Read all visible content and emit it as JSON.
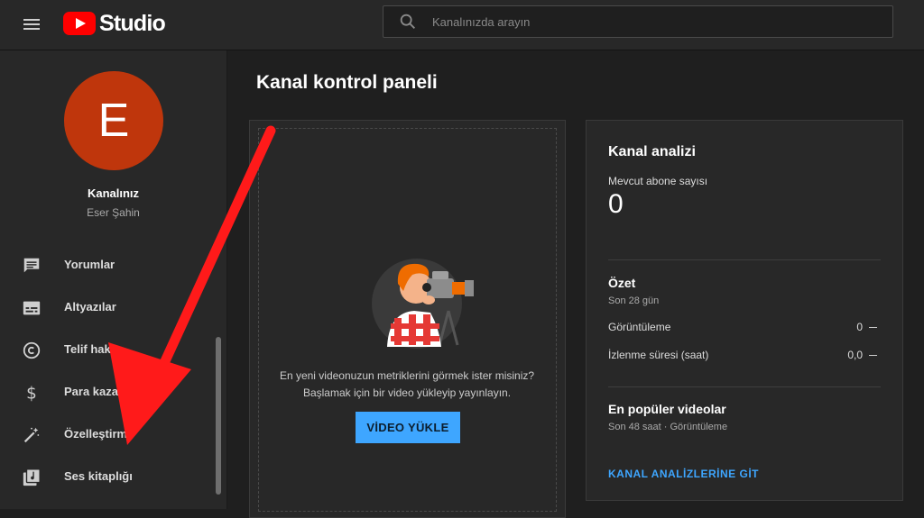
{
  "header": {
    "logo_text": "Studio",
    "search_placeholder": "Kanalınızda arayın"
  },
  "channel": {
    "avatar_letter": "E",
    "avatar_color": "#bf360c",
    "name": "Kanalınız",
    "owner": "Eser Şahin"
  },
  "sidebar": {
    "items": [
      {
        "label": "Yorumlar",
        "icon": "comment-icon"
      },
      {
        "label": "Altyazılar",
        "icon": "subtitles-icon"
      },
      {
        "label": "Telif hakkı",
        "icon": "copyright-icon"
      },
      {
        "label": "Para kazanma",
        "icon": "dollar-icon"
      },
      {
        "label": "Özelleştirme",
        "icon": "magic-wand-icon"
      },
      {
        "label": "Ses kitaplığı",
        "icon": "audio-library-icon"
      }
    ]
  },
  "main": {
    "title": "Kanal kontrol paneli",
    "upload": {
      "line1": "En yeni videonuzun metriklerini görmek ister misiniz?",
      "line2": "Başlamak için bir video yükleyip yayınlayın.",
      "button": "VİDEO YÜKLE"
    },
    "analytics": {
      "title": "Kanal analizi",
      "subs_label": "Mevcut abone sayısı",
      "subs_value": "0",
      "summary_title": "Özet",
      "summary_period": "Son 28 gün",
      "rows": [
        {
          "label": "Görüntüleme",
          "value": "0"
        },
        {
          "label": "İzlenme süresi (saat)",
          "value": "0,0"
        }
      ],
      "top_title": "En popüler videolar",
      "top_sub": "Son 48 saat · Görüntüleme",
      "link": "KANAL ANALİZLERİNE GİT"
    }
  },
  "colors": {
    "accent": "#3ea6ff",
    "annotation_arrow": "#ff1a1a"
  }
}
